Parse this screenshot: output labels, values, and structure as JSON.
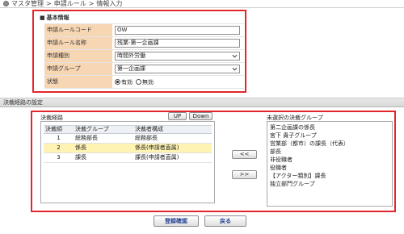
{
  "breadcrumb": {
    "items": [
      "マスタ管理",
      "申請ルール",
      "情報入力"
    ],
    "separator": ">"
  },
  "basic_info": {
    "marker": "■",
    "heading": "基本情報",
    "rule_code": {
      "label": "申請ルールコード",
      "value": "OW"
    },
    "rule_name": {
      "label": "申請ルール名称",
      "value": "残業-第一企画課"
    },
    "application_type": {
      "label": "申請種別",
      "selected": "時間外労働"
    },
    "application_group": {
      "label": "申請グループ",
      "selected": "第一企画課"
    },
    "status": {
      "label": "状態",
      "options": [
        {
          "label": "有効",
          "checked": true
        },
        {
          "label": "無効",
          "checked": false
        }
      ]
    }
  },
  "route_section": {
    "title": "決裁経路の設定",
    "route": {
      "label": "決裁経路",
      "up_label": "UP",
      "down_label": "Down",
      "columns": [
        "決裁順",
        "決裁グループ",
        "決裁者構成"
      ],
      "rows": [
        {
          "order": 1,
          "group": "総務部長",
          "composition": "総務部長",
          "selected": false
        },
        {
          "order": 2,
          "group": "係長",
          "composition": "係長(申請者直属)",
          "selected": true
        },
        {
          "order": 3,
          "group": "課長",
          "composition": "課長(申請者直属)",
          "selected": false
        }
      ]
    },
    "move_left_label": "<<",
    "move_right_label": ">>",
    "unselected": {
      "label": "未選択の決裁グループ",
      "items": [
        "第二企画課の係長",
        "宮下 貴子グループ",
        "営業部（都市）の課長（代表）",
        "部長",
        "非役職者",
        "役職者",
        "【アクター類別】課長",
        "独立部門グループ"
      ]
    }
  },
  "footer": {
    "confirm_label": "登録確認",
    "back_label": "戻る"
  },
  "colors": {
    "highlight_border": "#e3262b",
    "label_background": "#f7d6b4",
    "selected_row_background": "#fff3b3",
    "section_bar_background": "#d9d9d9",
    "footer_button_text": "#223f8f"
  },
  "icons": {
    "breadcrumb_bullet": "circle-bullet-icon",
    "select_arrow": "chevron-down-icon",
    "radio": "radio-button-icon"
  }
}
